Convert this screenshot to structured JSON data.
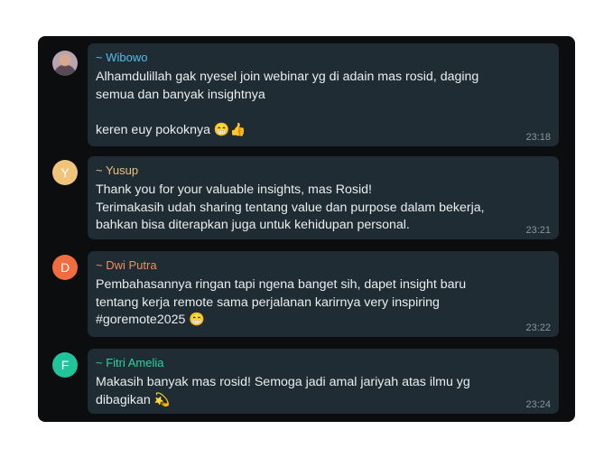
{
  "messages": [
    {
      "sender": "~ Wibowo",
      "sender_color": "#53bdeb",
      "avatar_type": "photo",
      "avatar_letter": "",
      "avatar_color": "#b7a5b1",
      "text": "Alhamdulillah gak nyesel join webinar yg di adain mas rosid, daging semua dan banyak insightnya\n\nkeren euy pokoknya 😁👍",
      "time": "23:18"
    },
    {
      "sender": "~ Yusup",
      "sender_color": "#e8c07a",
      "avatar_type": "letter",
      "avatar_letter": "Y",
      "avatar_color": "#f2c37a",
      "text": "Thank you for your valuable insights, mas Rosid!\nTerimakasih udah sharing tentang value dan purpose dalam bekerja, bahkan bisa diterapkan juga untuk kehidupan personal.",
      "time": "23:21"
    },
    {
      "sender": "~ Dwi Putra",
      "sender_color": "#f08d61",
      "avatar_type": "letter",
      "avatar_letter": "D",
      "avatar_color": "#f16d40",
      "text": "Pembahasannya ringan tapi ngena banget sih, dapet insight baru tentang kerja remote sama perjalanan karirnya very inspiring #goremote2025 😁",
      "time": "23:22"
    },
    {
      "sender": "~ Fitri Amelia",
      "sender_color": "#26d5a1",
      "avatar_type": "letter",
      "avatar_letter": "F",
      "avatar_color": "#1fc49a",
      "text": "Makasih banyak mas rosid! Semoga jadi amal jariyah atas ilmu yg dibagikan 💫",
      "time": "23:24"
    }
  ]
}
